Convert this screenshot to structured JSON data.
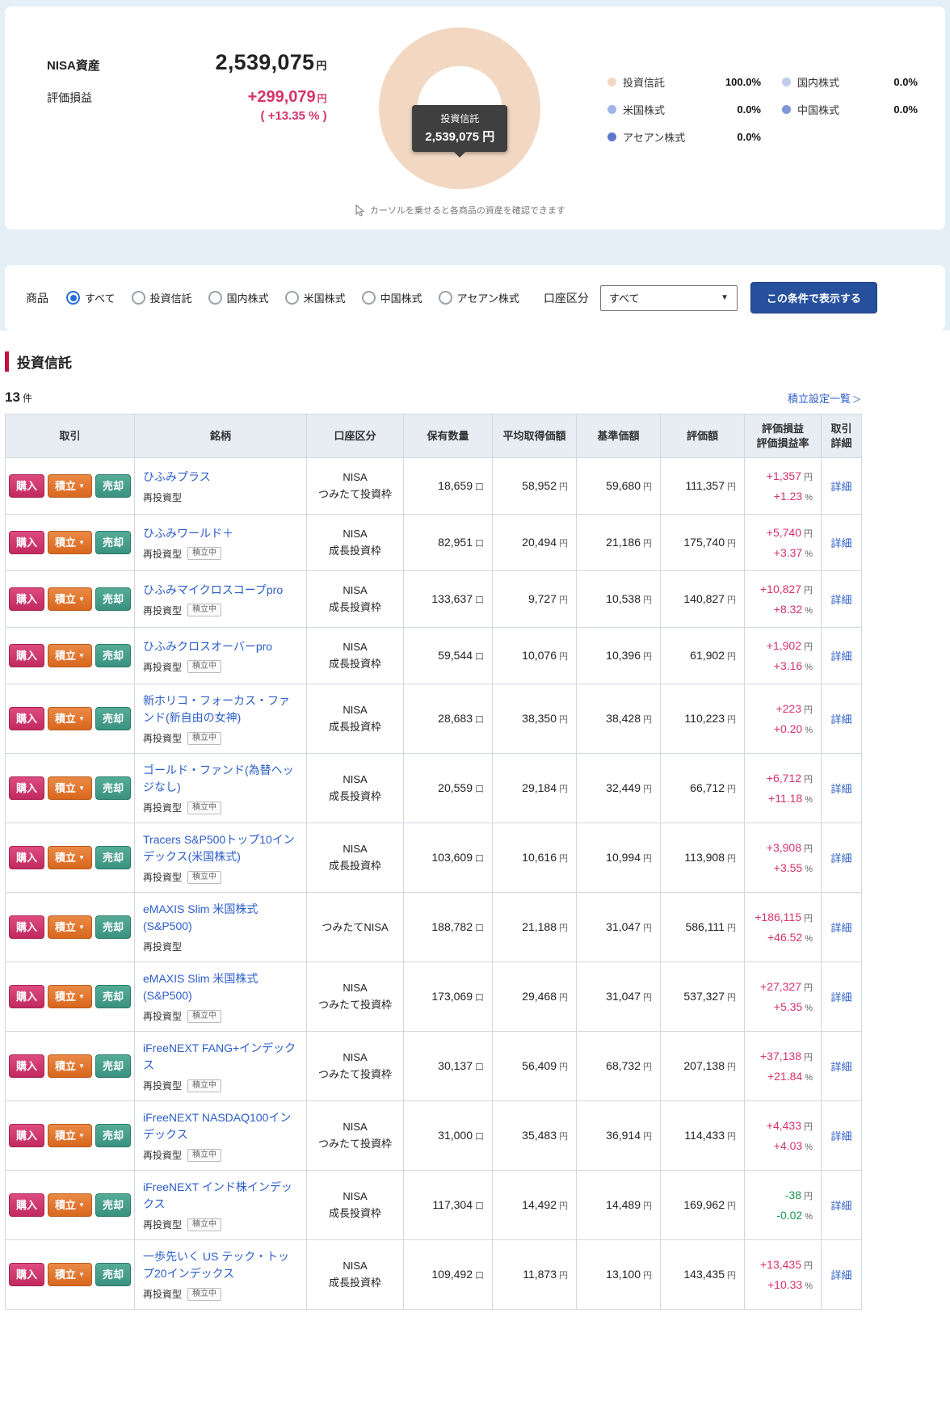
{
  "summary": {
    "asset_label": "NISA資産",
    "asset_value": "2,539,075",
    "asset_unit": "円",
    "pl_label": "評価損益",
    "pl_value": "+299,079",
    "pl_unit": "円",
    "pl_rate": "( +13.35 % )",
    "tooltip": {
      "label": "投資信託",
      "value": "2,539,075 円"
    },
    "hint": "カーソルを乗せると各商品の資産を確認できます",
    "donut_color": "#f2d8c3",
    "legend_col1": [
      {
        "label": "投資信託",
        "value": "100.0%",
        "color": "#f2d8c3"
      },
      {
        "label": "米国株式",
        "value": "0.0%",
        "color": "#9eb5e8"
      },
      {
        "label": "アセアン株式",
        "value": "0.0%",
        "color": "#5d78cb"
      }
    ],
    "legend_col2": [
      {
        "label": "国内株式",
        "value": "0.0%",
        "color": "#c0cbf0"
      },
      {
        "label": "中国株式",
        "value": "0.0%",
        "color": "#7e97da"
      }
    ]
  },
  "chart_data": {
    "type": "pie",
    "title": "NISA資産構成",
    "categories": [
      "投資信託",
      "国内株式",
      "米国株式",
      "中国株式",
      "アセアン株式"
    ],
    "values": [
      100.0,
      0.0,
      0.0,
      0.0,
      0.0
    ],
    "total_label": "投資信託 2,539,075 円"
  },
  "filter": {
    "product_label": "商品",
    "options": [
      "すべて",
      "投資信託",
      "国内株式",
      "米国株式",
      "中国株式",
      "アセアン株式"
    ],
    "selected": "すべて",
    "account_label": "口座区分",
    "account_value": "すべて",
    "select_arrow": "▼",
    "apply_button": "この条件で表示する"
  },
  "section": {
    "title": "投資信託",
    "count": "13",
    "count_unit": "件",
    "link": "積立設定一覧",
    "link_chevron": "＞"
  },
  "table": {
    "headers": {
      "trade": "取引",
      "name": "銘柄",
      "account": "口座区分",
      "quantity": "保有数量",
      "avg_price": "平均取得価額",
      "base_price": "基準価額",
      "valuation": "評価額",
      "pl_line1": "評価損益",
      "pl_line2": "評価損益率",
      "detail_line1": "取引",
      "detail_line2": "詳細"
    },
    "buttons": {
      "buy": "購入",
      "accumulate": "積立",
      "sell": "売却",
      "detail": "詳細"
    },
    "accumulate_caret": "▼",
    "badge_accumulating": "積立中",
    "units": {
      "quantity": "口",
      "yen": "円",
      "percent": "%"
    },
    "rows": [
      {
        "name": "ひふみプラス",
        "type": "再投資型",
        "accumulating": false,
        "account_line1": "NISA",
        "account_line2": "つみたて投資枠",
        "quantity": "18,659",
        "avg_price": "58,952",
        "base_price": "59,680",
        "valuation": "111,357",
        "pl_amount": "+1,357",
        "pl_rate": "+1.23",
        "negative": false
      },
      {
        "name": "ひふみワールド＋",
        "type": "再投資型",
        "accumulating": true,
        "account_line1": "NISA",
        "account_line2": "成長投資枠",
        "quantity": "82,951",
        "avg_price": "20,494",
        "base_price": "21,186",
        "valuation": "175,740",
        "pl_amount": "+5,740",
        "pl_rate": "+3.37",
        "negative": false
      },
      {
        "name": "ひふみマイクロスコープpro",
        "type": "再投資型",
        "accumulating": true,
        "account_line1": "NISA",
        "account_line2": "成長投資枠",
        "quantity": "133,637",
        "avg_price": "9,727",
        "base_price": "10,538",
        "valuation": "140,827",
        "pl_amount": "+10,827",
        "pl_rate": "+8.32",
        "negative": false
      },
      {
        "name": "ひふみクロスオーバーpro",
        "type": "再投資型",
        "accumulating": true,
        "account_line1": "NISA",
        "account_line2": "成長投資枠",
        "quantity": "59,544",
        "avg_price": "10,076",
        "base_price": "10,396",
        "valuation": "61,902",
        "pl_amount": "+1,902",
        "pl_rate": "+3.16",
        "negative": false
      },
      {
        "name": "新ホリコ・フォーカス・ファンド(新自由の女神)",
        "type": "再投資型",
        "accumulating": true,
        "account_line1": "NISA",
        "account_line2": "成長投資枠",
        "quantity": "28,683",
        "avg_price": "38,350",
        "base_price": "38,428",
        "valuation": "110,223",
        "pl_amount": "+223",
        "pl_rate": "+0.20",
        "negative": false
      },
      {
        "name": "ゴールド・ファンド(為替ヘッジなし)",
        "type": "再投資型",
        "accumulating": true,
        "account_line1": "NISA",
        "account_line2": "成長投資枠",
        "quantity": "20,559",
        "avg_price": "29,184",
        "base_price": "32,449",
        "valuation": "66,712",
        "pl_amount": "+6,712",
        "pl_rate": "+11.18",
        "negative": false
      },
      {
        "name": "Tracers S&P500トップ10インデックス(米国株式)",
        "type": "再投資型",
        "accumulating": true,
        "account_line1": "NISA",
        "account_line2": "成長投資枠",
        "quantity": "103,609",
        "avg_price": "10,616",
        "base_price": "10,994",
        "valuation": "113,908",
        "pl_amount": "+3,908",
        "pl_rate": "+3.55",
        "negative": false
      },
      {
        "name": "eMAXIS Slim 米国株式(S&P500)",
        "type": "再投資型",
        "accumulating": false,
        "account_line1": "つみたてNISA",
        "account_line2": "",
        "quantity": "188,782",
        "avg_price": "21,188",
        "base_price": "31,047",
        "valuation": "586,111",
        "pl_amount": "+186,115",
        "pl_rate": "+46.52",
        "negative": false
      },
      {
        "name": "eMAXIS Slim 米国株式(S&P500)",
        "type": "再投資型",
        "accumulating": true,
        "account_line1": "NISA",
        "account_line2": "つみたて投資枠",
        "quantity": "173,069",
        "avg_price": "29,468",
        "base_price": "31,047",
        "valuation": "537,327",
        "pl_amount": "+27,327",
        "pl_rate": "+5.35",
        "negative": false
      },
      {
        "name": "iFreeNEXT FANG+インデックス",
        "type": "再投資型",
        "accumulating": true,
        "account_line1": "NISA",
        "account_line2": "つみたて投資枠",
        "quantity": "30,137",
        "avg_price": "56,409",
        "base_price": "68,732",
        "valuation": "207,138",
        "pl_amount": "+37,138",
        "pl_rate": "+21.84",
        "negative": false
      },
      {
        "name": "iFreeNEXT NASDAQ100インデックス",
        "type": "再投資型",
        "accumulating": true,
        "account_line1": "NISA",
        "account_line2": "つみたて投資枠",
        "quantity": "31,000",
        "avg_price": "35,483",
        "base_price": "36,914",
        "valuation": "114,433",
        "pl_amount": "+4,433",
        "pl_rate": "+4.03",
        "negative": false
      },
      {
        "name": "iFreeNEXT インド株インデックス",
        "type": "再投資型",
        "accumulating": true,
        "account_line1": "NISA",
        "account_line2": "成長投資枠",
        "quantity": "117,304",
        "avg_price": "14,492",
        "base_price": "14,489",
        "valuation": "169,962",
        "pl_amount": "-38",
        "pl_rate": "-0.02",
        "negative": true
      },
      {
        "name": "一歩先いく US テック・トップ20インデックス",
        "type": "再投資型",
        "accumulating": true,
        "account_line1": "NISA",
        "account_line2": "成長投資枠",
        "quantity": "109,492",
        "avg_price": "11,873",
        "base_price": "13,100",
        "valuation": "143,435",
        "pl_amount": "+13,435",
        "pl_rate": "+10.33",
        "negative": false
      }
    ]
  }
}
